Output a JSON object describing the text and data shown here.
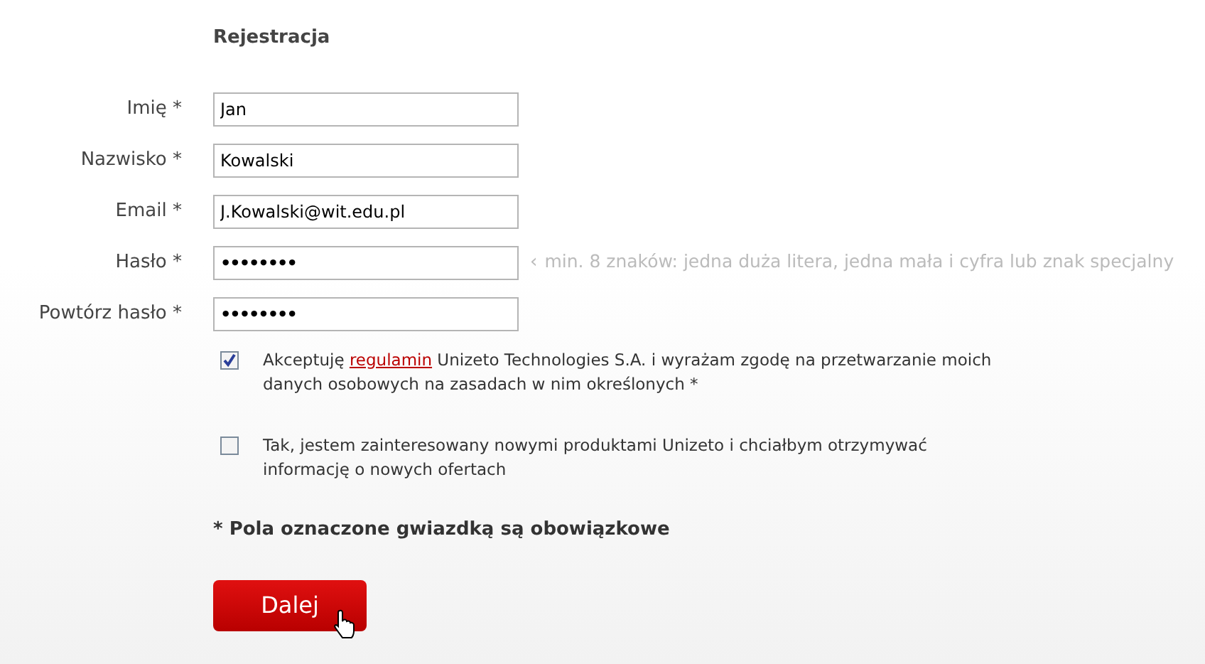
{
  "title": "Rejestracja",
  "fields": [
    {
      "label": "Imię *",
      "value": "Jan",
      "kind": "text"
    },
    {
      "label": "Nazwisko *",
      "value": "Kowalski",
      "kind": "text"
    },
    {
      "label": "Email *",
      "value": "J.Kowalski@wit.edu.pl",
      "kind": "text"
    },
    {
      "label": "Hasło *",
      "value": "••••••••",
      "kind": "password",
      "hint_marker": "‹",
      "hint": "min. 8 znaków: jedna duża litera, jedna mała i cyfra lub znak specjalny"
    },
    {
      "label": "Powtórz hasło *",
      "value": "••••••••",
      "kind": "password"
    }
  ],
  "consents": [
    {
      "checked": true,
      "text_before": "Akceptuję ",
      "link": "regulamin",
      "text_after": " Unizeto Technologies S.A. i wyrażam zgodę na przetwarzanie moich danych osobowych na zasadach w nim określonych *"
    },
    {
      "checked": false,
      "text_before": "Tak, jestem zainteresowany nowymi produktami Unizeto i chciałbym otrzymywać informację o nowych ofertach"
    }
  ],
  "required_note": "* Pola oznaczone gwiazdką są obowiązkowe",
  "submit": {
    "label": "Dalej"
  }
}
